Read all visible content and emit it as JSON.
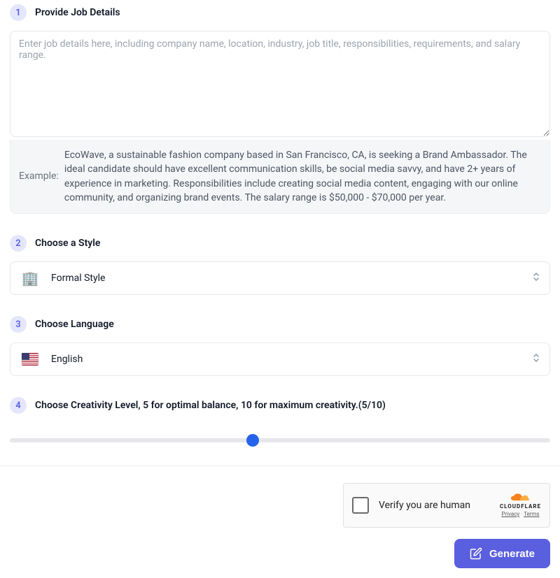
{
  "steps": {
    "step1": {
      "number": "1",
      "title": "Provide Job Details",
      "textarea_placeholder": "Enter job details here, including company name, location, industry, job title, responsibilities, requirements, and salary range.",
      "example_label": "Example:",
      "example_text": "EcoWave, a sustainable fashion company based in San Francisco, CA, is seeking a Brand Ambassador. The ideal candidate should have excellent communication skills, be social media savvy, and have 2+ years of experience in marketing. Responsibilities include creating social media content, engaging with our online community, and organizing brand events. The salary range is $50,000 - $70,000 per year."
    },
    "step2": {
      "number": "2",
      "title": "Choose a Style",
      "selected_label": "Formal Style",
      "selected_icon": "🏢"
    },
    "step3": {
      "number": "3",
      "title": "Choose Language",
      "selected_label": "English"
    },
    "step4": {
      "number": "4",
      "title_prefix": "Choose Creativity Level, 5 for optimal balance, 10 for maximum creativity.",
      "value_display": "(5/10)"
    }
  },
  "captcha": {
    "text": "Verify you are human",
    "brand": "CLOUDFLARE",
    "privacy": "Privacy",
    "separator": " · ",
    "terms": "Terms"
  },
  "generate_button_label": "Generate"
}
